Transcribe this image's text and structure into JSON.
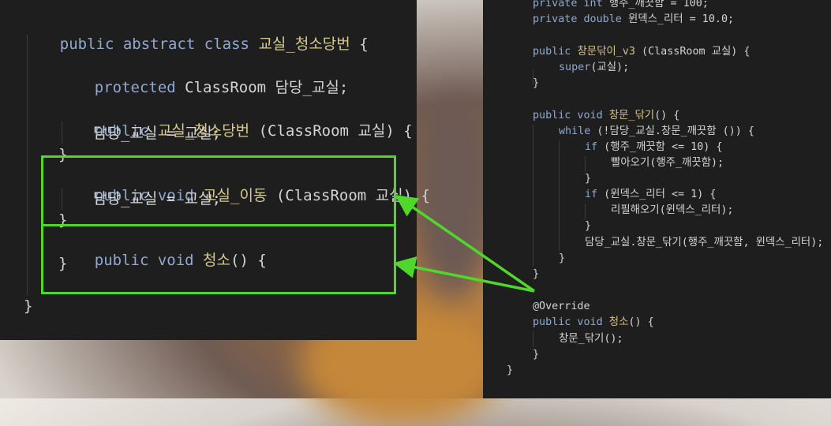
{
  "left_code": {
    "class_decl": {
      "kw": "public abstract class ",
      "name": "교실_청소당번",
      "end": " {"
    },
    "field": {
      "kw": "protected ",
      "type": "ClassRoom",
      "name": " 담당_교실;"
    },
    "ctor": {
      "kw": "public ",
      "name": "교실_청소당번",
      "params": " (ClassRoom 교실) {"
    },
    "ctor_body": "담당_교실 = 교실;",
    "brace1": "}",
    "move_method": {
      "kw": "public void ",
      "name": "교실_이동",
      "params": " (ClassRoom 교실) {"
    },
    "move_body": "담당_교실 = 교실;",
    "brace2": "}",
    "clean_method": {
      "kw": "public void ",
      "name": "청소",
      "params": "() {"
    },
    "brace3": "}",
    "class_end": "}"
  },
  "right_code": {
    "l1": {
      "kw": "private int ",
      "rest": "행주_깨끗함 = 100;"
    },
    "l2": {
      "kw": "private double ",
      "rest": "윈덱스_리터 = 10.0;"
    },
    "l3": {
      "kw": "public ",
      "name": "창문닦이_v3",
      "rest": " (ClassRoom 교실) {"
    },
    "l4": {
      "kw": "super",
      "rest": "(교실);"
    },
    "l5": "}",
    "l6": {
      "kw": "public void ",
      "name": "창문_닦기",
      "rest": "() {"
    },
    "l7": {
      "kw": "while",
      "rest": " (!담당_교실.창문_깨끗함 ()) {"
    },
    "l8": {
      "kw": "if",
      "rest": " (행주_깨끗함 <= 10) {"
    },
    "l9": "빨아오기(행주_깨끗함);",
    "l10": "}",
    "l11": {
      "kw": "if",
      "rest": " (윈덱스_리터 <= 1) {"
    },
    "l12": "리필해오기(윈덱스_리터);",
    "l13": "}",
    "l14": "담당_교실.창문_닦기(행주_깨끗함, 윈덱스_리터);",
    "l15": "}",
    "l16": "}",
    "l17": "@Override",
    "l18": {
      "kw": "public void ",
      "name": "청소",
      "rest": "() {"
    },
    "l19": "창문_닦기();",
    "l20": "}",
    "l21": "}"
  },
  "colors": {
    "highlight": "#4fd72b",
    "editor_bg": "#1e1e1e",
    "keyword": "#8fa9d0",
    "identifier": "#d6c98c"
  }
}
